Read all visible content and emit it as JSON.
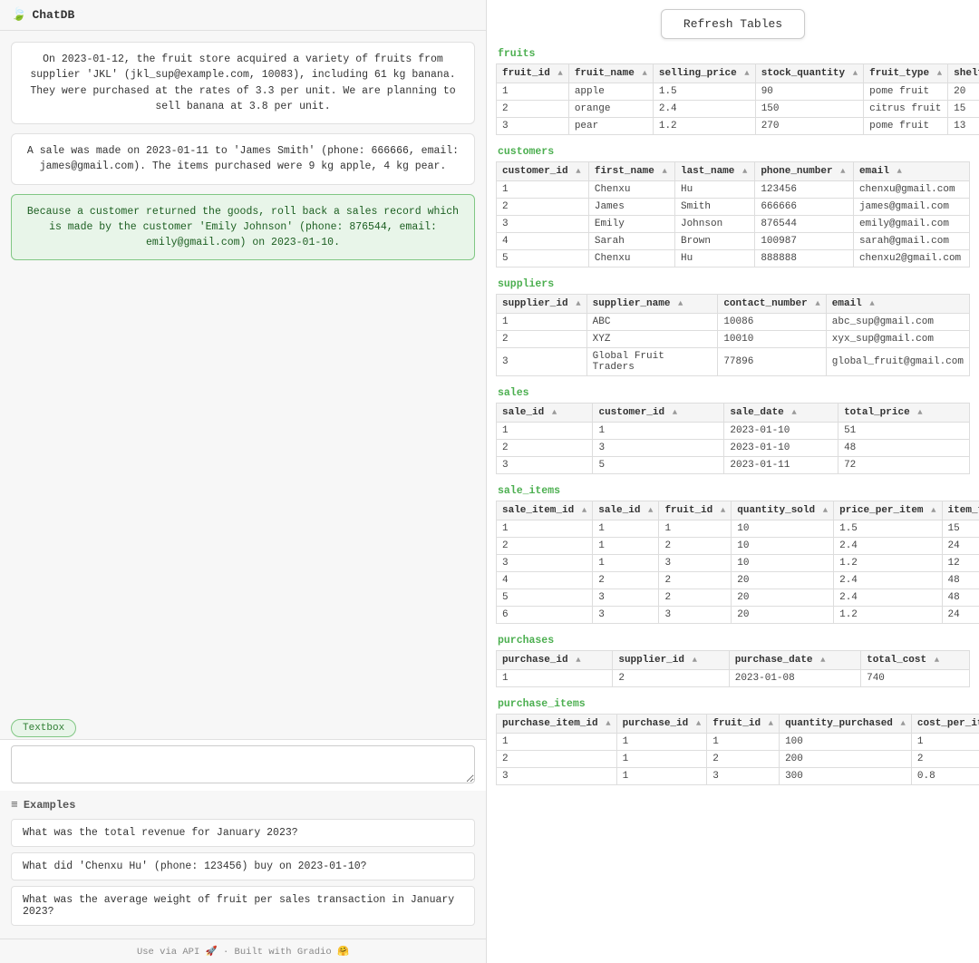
{
  "left_panel": {
    "header": {
      "icon": "🍃",
      "title": "ChatDB"
    },
    "textbox_label": "Textbox",
    "input_placeholder": "",
    "examples_header": {
      "icon": "≡",
      "title": "Examples"
    },
    "example_bubbles": [
      {
        "text": "On 2023-01-12, the fruit store acquired a variety of fruits from supplier 'JKL' (jkl_sup@example.com, 10083), including 61 kg banana. They were purchased at the rates of 3.3 per unit. We are planning to sell banana at 3.8 per unit.",
        "highlighted": false
      },
      {
        "text": "A sale was made on 2023-01-11 to 'James Smith' (phone: 666666, email: james@gmail.com). The items purchased were 9 kg apple, 4 kg pear.",
        "highlighted": false
      },
      {
        "text": "Because a customer returned the goods, roll back a sales record which is made by the customer 'Emily Johnson' (phone: 876544, email: emily@gmail.com) on 2023-01-10.",
        "highlighted": true
      }
    ],
    "example_items": [
      "What was the total revenue for January 2023?",
      "What did 'Chenxu Hu' (phone: 123456) buy on 2023-01-10?",
      "What was the average weight of fruit per sales transaction in January 2023?"
    ]
  },
  "right_panel": {
    "refresh_button": "Refresh Tables",
    "tables": {
      "fruits": {
        "label": "fruits",
        "columns": [
          "fruit_id",
          "fruit_name",
          "selling_price",
          "stock_quantity",
          "fruit_type",
          "shelf_l"
        ],
        "rows": [
          [
            "1",
            "apple",
            "1.5",
            "90",
            "pome fruit",
            "20"
          ],
          [
            "2",
            "orange",
            "2.4",
            "150",
            "citrus fruit",
            "15"
          ],
          [
            "3",
            "pear",
            "1.2",
            "270",
            "pome fruit",
            "13"
          ]
        ]
      },
      "customers": {
        "label": "customers",
        "columns": [
          "customer_id",
          "first_name",
          "last_name",
          "phone_number",
          "email"
        ],
        "rows": [
          [
            "1",
            "Chenxu",
            "Hu",
            "123456",
            "chenxu@gmail.com"
          ],
          [
            "2",
            "James",
            "Smith",
            "666666",
            "james@gmail.com"
          ],
          [
            "3",
            "Emily",
            "Johnson",
            "876544",
            "emily@gmail.com"
          ],
          [
            "4",
            "Sarah",
            "Brown",
            "100987",
            "sarah@gmail.com"
          ],
          [
            "5",
            "Chenxu",
            "Hu",
            "888888",
            "chenxu2@gmail.com"
          ]
        ]
      },
      "suppliers": {
        "label": "suppliers",
        "columns": [
          "supplier_id",
          "supplier_name",
          "contact_number",
          "email"
        ],
        "rows": [
          [
            "1",
            "ABC",
            "10086",
            "abc_sup@gmail.com"
          ],
          [
            "2",
            "XYZ",
            "10010",
            "xyx_sup@gmail.com"
          ],
          [
            "3",
            "Global Fruit Traders",
            "77896",
            "global_fruit@gmail.com"
          ]
        ]
      },
      "sales": {
        "label": "sales",
        "columns": [
          "sale_id",
          "customer_id",
          "sale_date",
          "total_price"
        ],
        "rows": [
          [
            "1",
            "1",
            "2023-01-10",
            "51"
          ],
          [
            "2",
            "3",
            "2023-01-10",
            "48"
          ],
          [
            "3",
            "5",
            "2023-01-11",
            "72"
          ]
        ]
      },
      "sale_items": {
        "label": "sale_items",
        "columns": [
          "sale_item_id",
          "sale_id",
          "fruit_id",
          "quantity_sold",
          "price_per_item",
          "item_tot"
        ],
        "rows": [
          [
            "1",
            "1",
            "1",
            "10",
            "1.5",
            "15"
          ],
          [
            "2",
            "1",
            "2",
            "10",
            "2.4",
            "24"
          ],
          [
            "3",
            "1",
            "3",
            "10",
            "1.2",
            "12"
          ],
          [
            "4",
            "2",
            "2",
            "20",
            "2.4",
            "48"
          ],
          [
            "5",
            "3",
            "2",
            "20",
            "2.4",
            "48"
          ],
          [
            "6",
            "3",
            "3",
            "20",
            "1.2",
            "24"
          ]
        ]
      },
      "purchases": {
        "label": "purchases",
        "columns": [
          "purchase_id",
          "supplier_id",
          "purchase_date",
          "total_cost"
        ],
        "rows": [
          [
            "1",
            "2",
            "2023-01-08",
            "740"
          ]
        ]
      },
      "purchase_items": {
        "label": "purchase_items",
        "columns": [
          "purchase_item_id",
          "purchase_id",
          "fruit_id",
          "quantity_purchased",
          "cost_per_item"
        ],
        "rows": [
          [
            "1",
            "1",
            "1",
            "100",
            "1"
          ],
          [
            "2",
            "1",
            "2",
            "200",
            "2"
          ],
          [
            "3",
            "1",
            "3",
            "300",
            "0.8"
          ]
        ]
      }
    }
  },
  "footer": {
    "text": "Use via API 🚀 · Built with Gradio 🤗"
  }
}
